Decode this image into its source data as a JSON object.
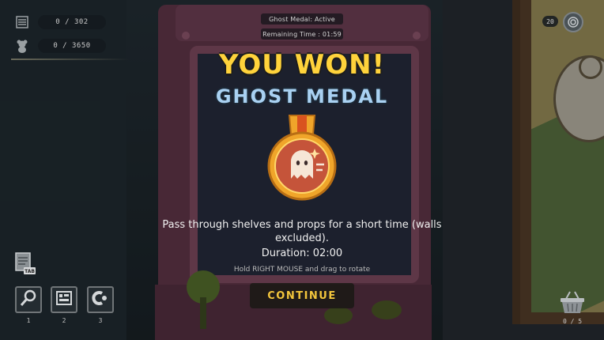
{
  "hud": {
    "stat1": {
      "icon": "list-icon",
      "value": "0 / 302"
    },
    "stat2": {
      "icon": "teddy-bear-icon",
      "value": "0 / 3650"
    },
    "tab_note_icon": "notes-tab-icon",
    "tab_note_label": "TAB",
    "tools": [
      {
        "icon": "magnifier-icon",
        "key": "1"
      },
      {
        "icon": "map-icon",
        "key": "2"
      },
      {
        "icon": "magnet-icon",
        "key": "3"
      }
    ],
    "coins": {
      "value": "20",
      "icon": "coin-icon"
    },
    "basket": {
      "icon": "basket-icon",
      "value": "0 / 5"
    }
  },
  "status": {
    "medal_active": "Ghost Medal: Active",
    "remaining_time": "Remaining Time : 01:59"
  },
  "result": {
    "headline": "YOU WON!",
    "prize_name": "GHOST MEDAL",
    "medal_icon": "ghost-medal-icon",
    "description": "Pass through shelves and props for a short time (walls excluded).",
    "duration": "Duration: 02:00",
    "hint": "Hold RIGHT MOUSE and drag to rotate",
    "continue_label": "CONTINUE"
  },
  "colors": {
    "headline": "#ffd33b",
    "prize_name": "#a9d1f2",
    "continue_text": "#f2c53c",
    "medal_gold": "#f0a52a",
    "medal_inner": "#c5543a"
  }
}
